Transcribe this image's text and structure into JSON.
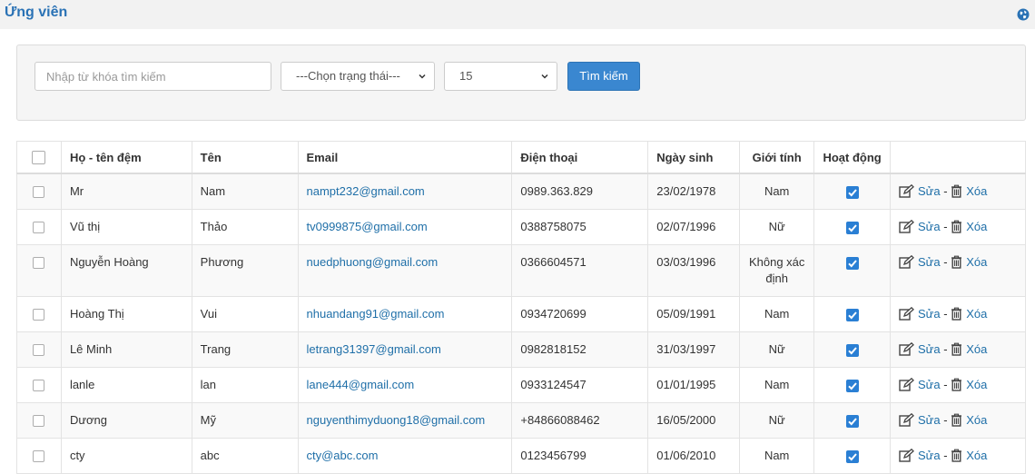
{
  "page": {
    "title": "Ứng viên",
    "globe_icon": "globe-icon"
  },
  "filters": {
    "search_placeholder": "Nhập từ khóa tìm kiếm",
    "status_selected": "---Chọn trạng thái---",
    "page_size_selected": "15",
    "search_button": "Tìm kiếm"
  },
  "table": {
    "headers": {
      "last_name": "Họ - tên đệm",
      "first_name": "Tên",
      "email": "Email",
      "phone": "Điện thoại",
      "birthday": "Ngày sinh",
      "gender": "Giới tính",
      "active": "Hoạt động"
    },
    "actions": {
      "edit": "Sửa",
      "separator": "-",
      "delete": "Xóa"
    },
    "rows": [
      {
        "last": "Mr",
        "first": "Nam",
        "email": "nampt232@gmail.com",
        "phone": "0989.363.829",
        "birthday": "23/02/1978",
        "gender": "Nam",
        "active": true
      },
      {
        "last": "Vũ thị",
        "first": "Thảo",
        "email": "tv0999875@gmail.com",
        "phone": "0388758075",
        "birthday": "02/07/1996",
        "gender": "Nữ",
        "active": true
      },
      {
        "last": "Nguyễn Hoàng",
        "first": "Phương",
        "email": "nuedphuong@gmail.com",
        "phone": "0366604571",
        "birthday": "03/03/1996",
        "gender": "Không xác định",
        "active": true
      },
      {
        "last": "Hoàng Thị",
        "first": "Vui",
        "email": "nhuandang91@gmail.com",
        "phone": "0934720699",
        "birthday": "05/09/1991",
        "gender": "Nam",
        "active": true
      },
      {
        "last": "Lê Minh",
        "first": "Trang",
        "email": "letrang31397@gmail.com",
        "phone": "0982818152",
        "birthday": "31/03/1997",
        "gender": "Nữ",
        "active": true
      },
      {
        "last": "lanle",
        "first": "lan",
        "email": "lane444@gmail.com",
        "phone": "0933124547",
        "birthday": "01/01/1995",
        "gender": "Nam",
        "active": true
      },
      {
        "last": "Dương",
        "first": "Mỹ",
        "email": "nguyenthimyduong18@gmail.com",
        "phone": "+84866088462",
        "birthday": "16/05/2000",
        "gender": "Nữ",
        "active": true
      },
      {
        "last": "cty",
        "first": "abc",
        "email": "cty@abc.com",
        "phone": "0123456799",
        "birthday": "01/06/2010",
        "gender": "Nam",
        "active": true
      }
    ]
  },
  "colors": {
    "accent": "#2a72b5",
    "button": "#3a87d0",
    "link": "#1f6fa8",
    "checkbox": "#2a7fd4"
  }
}
